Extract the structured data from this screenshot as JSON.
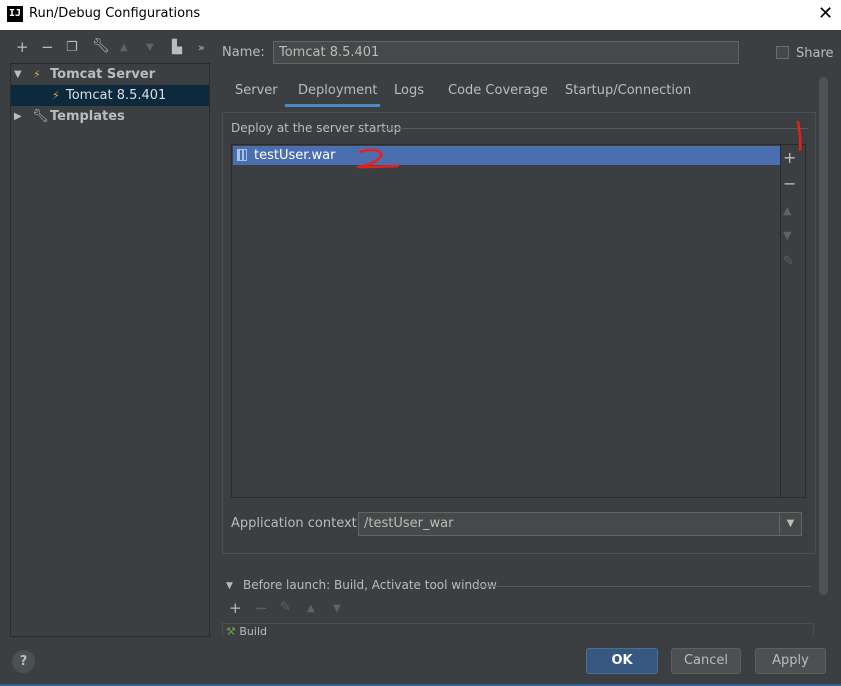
{
  "window": {
    "title": "Run/Debug Configurations",
    "app_icon_text": "IJ",
    "close_glyph": "✕"
  },
  "left_toolbar": {
    "icons": [
      "add-icon",
      "remove-icon",
      "copy-icon",
      "wrench-icon",
      "move-up-icon",
      "move-down-icon",
      "folder-icon",
      "more-icon"
    ]
  },
  "tree": {
    "items": [
      {
        "label": "Tomcat Server",
        "icon": "tomcat-icon",
        "expanded": true
      },
      {
        "label": "Tomcat 8.5.401",
        "icon": "tomcat-icon",
        "selected": true
      },
      {
        "label": "Templates",
        "icon": "wrench-icon",
        "expanded": false
      }
    ]
  },
  "name_field": {
    "label": "Name:",
    "value": "Tomcat 8.5.401"
  },
  "share": {
    "label": "Share",
    "checked": false
  },
  "tabs": [
    {
      "label": "Server"
    },
    {
      "label": "Deployment",
      "active": true
    },
    {
      "label": "Logs"
    },
    {
      "label": "Code Coverage"
    },
    {
      "label": "Startup/Connection"
    }
  ],
  "deployment": {
    "group_title": "Deploy at the server startup",
    "items": [
      {
        "label": "testUser.war",
        "selected": true
      }
    ],
    "side_buttons": [
      "add-icon",
      "remove-icon",
      "move-up-icon",
      "move-down-icon",
      "edit-icon"
    ]
  },
  "app_context": {
    "label": "Application context:",
    "value": "/testUser_war"
  },
  "before_launch": {
    "label": "Before launch: Build, Activate tool window",
    "item": "Build"
  },
  "buttons": {
    "help": "?",
    "ok": "OK",
    "cancel": "Cancel",
    "apply": "Apply"
  },
  "annotations": {
    "mark_1": "1",
    "mark_2": "2",
    "color": "#e8201a"
  },
  "colors": {
    "background": "#3c3f41",
    "selection": "#4b6eaf",
    "tree_selection": "#0d293e",
    "tab_accent": "#4a88c7",
    "ok_button": "#365880"
  }
}
